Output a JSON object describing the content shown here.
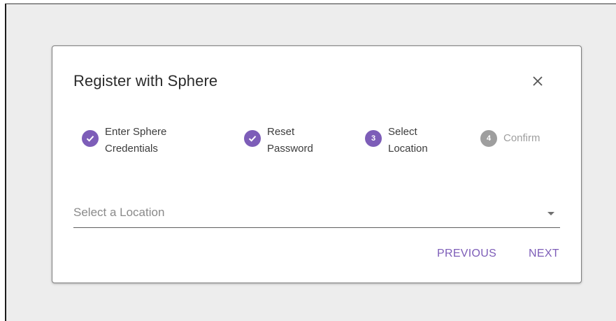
{
  "dialog": {
    "title": "Register with Sphere",
    "close_icon": "close-icon"
  },
  "stepper": {
    "steps": [
      {
        "label": "Enter Sphere\nCredentials",
        "state": "completed",
        "icon": "check-icon"
      },
      {
        "label": "Reset\nPassword",
        "state": "completed",
        "icon": "check-icon"
      },
      {
        "label": "Select\nLocation",
        "state": "active",
        "number": "3"
      },
      {
        "label": "Confirm",
        "state": "disabled",
        "number": "4"
      }
    ]
  },
  "location_select": {
    "placeholder": "Select a Location",
    "icon": "chevron-down-icon"
  },
  "actions": {
    "previous_label": "PREVIOUS",
    "next_label": "NEXT"
  },
  "colors": {
    "accent": "#7d5db8",
    "disabled": "#9e9e9e",
    "backdrop": "#ededed"
  }
}
